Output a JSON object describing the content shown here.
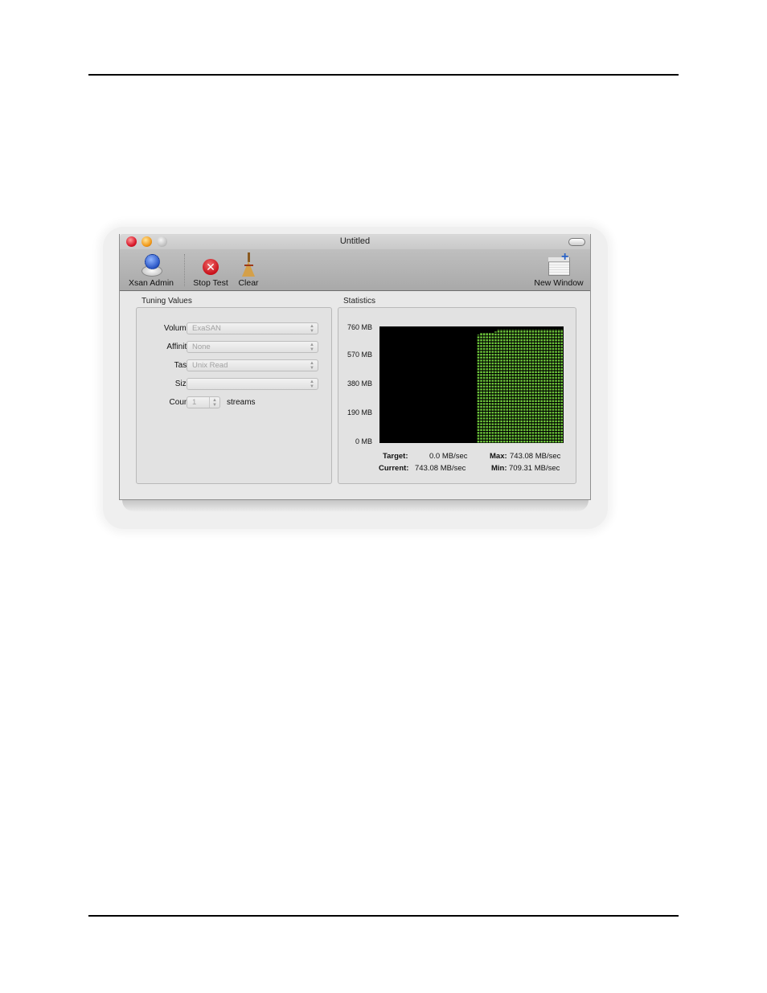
{
  "window": {
    "title": "Untitled",
    "traffic_lights": [
      "close",
      "minimize",
      "zoom"
    ]
  },
  "toolbar": {
    "items": [
      {
        "label": "Xsan Admin",
        "icon": "xsan-admin-icon"
      },
      {
        "label": "Stop Test",
        "icon": "stop-icon"
      },
      {
        "label": "Clear",
        "icon": "broom-icon"
      },
      {
        "label": "New Window",
        "icon": "new-window-icon"
      }
    ]
  },
  "tuning": {
    "group_label": "Tuning Values",
    "fields": [
      {
        "label": "Volume:",
        "value": "ExaSAN"
      },
      {
        "label": "Affinity:",
        "value": "None"
      },
      {
        "label": "Task:",
        "value": "Unix Read"
      },
      {
        "label": "Size:",
        "value": ""
      }
    ],
    "count": {
      "label": "Count:",
      "value": "1",
      "unit": "streams"
    }
  },
  "statistics": {
    "group_label": "Statistics",
    "target_label": "Target:",
    "target_value": "0.0 MB/sec",
    "current_label": "Current:",
    "current_value": "743.08 MB/sec",
    "max_label": "Max:",
    "max_value": "743.08 MB/sec",
    "min_label": "Min:",
    "min_value": "709.31 MB/sec"
  },
  "chart_data": {
    "type": "bar",
    "title": "",
    "xlabel": "",
    "ylabel": "",
    "y_ticks": [
      "760 MB",
      "570 MB",
      "380 MB",
      "190 MB",
      "0 MB"
    ],
    "ylim": [
      0,
      760
    ],
    "background": "#000000",
    "bar_color": "#6cc43a",
    "slots": 64,
    "empty_slots": 34,
    "values": [
      709,
      720,
      720,
      720,
      720,
      720,
      730,
      743,
      743,
      743,
      743,
      743,
      743,
      743,
      743,
      743,
      743,
      743,
      743,
      743,
      743,
      743,
      743,
      743,
      743,
      743,
      743,
      743,
      743,
      743
    ]
  }
}
